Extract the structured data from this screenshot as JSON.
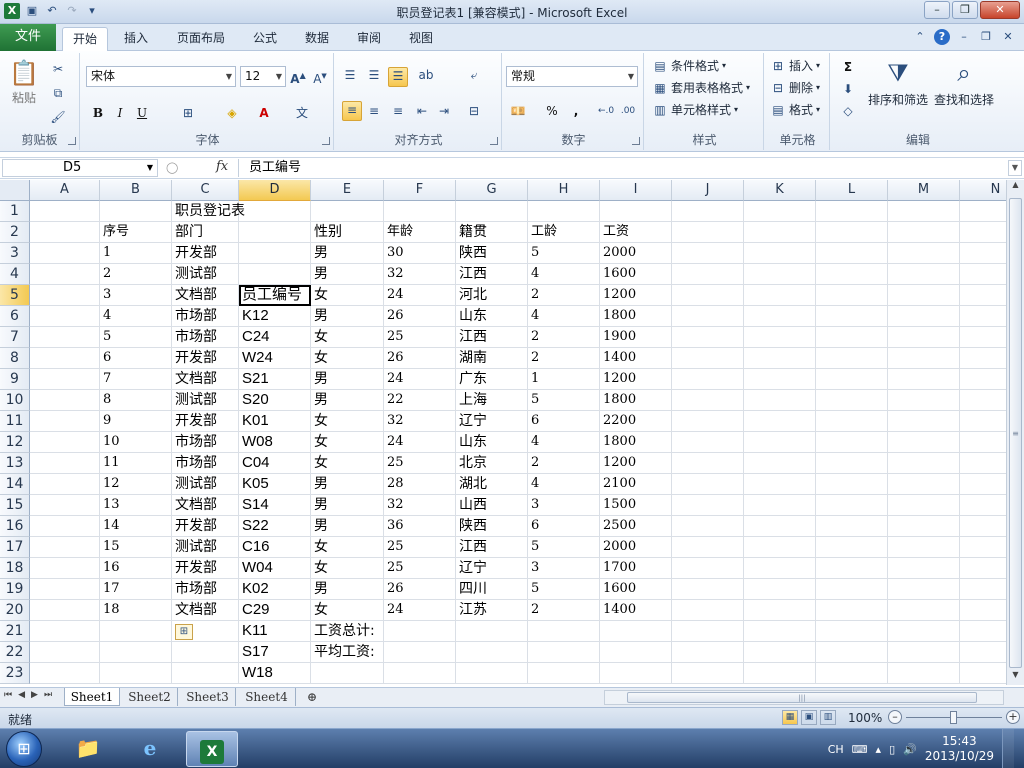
{
  "window": {
    "title": "职员登记表1  [兼容模式] - Microsoft Excel"
  },
  "tabs": [
    "开始",
    "插入",
    "页面布局",
    "公式",
    "数据",
    "审阅",
    "视图"
  ],
  "file_tab": "文件",
  "ribbon": {
    "clipboard": {
      "label": "剪贴板",
      "paste": "粘贴"
    },
    "font": {
      "label": "字体",
      "name": "宋体",
      "size": "12",
      "bold": "B",
      "italic": "I",
      "underline": "U"
    },
    "alignment": {
      "label": "对齐方式"
    },
    "number": {
      "label": "数字",
      "format": "常规",
      "percent": "%",
      "comma": ","
    },
    "styles": {
      "label": "样式",
      "conditional": "条件格式",
      "table": "套用表格格式",
      "cell": "单元格样式"
    },
    "cells": {
      "label": "单元格",
      "insert": "插入",
      "delete": "删除",
      "format": "格式"
    },
    "editing": {
      "label": "编辑",
      "sum": "Σ",
      "sort": "排序和筛选",
      "find": "查找和选择"
    }
  },
  "formula_bar": {
    "name_box": "D5",
    "fx": "fx",
    "content": "员工编号"
  },
  "columns": [
    "A",
    "B",
    "C",
    "D",
    "E",
    "F",
    "G",
    "H",
    "I",
    "J",
    "K",
    "L",
    "M",
    "N"
  ],
  "rows": [
    {
      "n": "1",
      "B": "",
      "C": "职员登记表",
      "D": "",
      "E": "",
      "F": "",
      "G": "",
      "H": "",
      "I": ""
    },
    {
      "n": "2",
      "B": "序号",
      "C": "部门",
      "D": "",
      "E": "性别",
      "F": "年龄",
      "G": "籍贯",
      "H": "工龄",
      "I": "工资"
    },
    {
      "n": "3",
      "B": "1",
      "C": "开发部",
      "D": "",
      "E": "男",
      "F": "30",
      "G": "陕西",
      "H": "5",
      "I": "2000"
    },
    {
      "n": "4",
      "B": "2",
      "C": "测试部",
      "D": "",
      "E": "男",
      "F": "32",
      "G": "江西",
      "H": "4",
      "I": "1600"
    },
    {
      "n": "5",
      "B": "3",
      "C": "文档部",
      "D": "员工编号",
      "E": "女",
      "F": "24",
      "G": "河北",
      "H": "2",
      "I": "1200"
    },
    {
      "n": "6",
      "B": "4",
      "C": "市场部",
      "D": "K12",
      "E": "男",
      "F": "26",
      "G": "山东",
      "H": "4",
      "I": "1800"
    },
    {
      "n": "7",
      "B": "5",
      "C": "市场部",
      "D": "C24",
      "E": "女",
      "F": "25",
      "G": "江西",
      "H": "2",
      "I": "1900"
    },
    {
      "n": "8",
      "B": "6",
      "C": "开发部",
      "D": "W24",
      "E": "女",
      "F": "26",
      "G": "湖南",
      "H": "2",
      "I": "1400"
    },
    {
      "n": "9",
      "B": "7",
      "C": "文档部",
      "D": "S21",
      "E": "男",
      "F": "24",
      "G": "广东",
      "H": "1",
      "I": "1200"
    },
    {
      "n": "10",
      "B": "8",
      "C": "测试部",
      "D": "S20",
      "E": "男",
      "F": "22",
      "G": "上海",
      "H": "5",
      "I": "1800"
    },
    {
      "n": "11",
      "B": "9",
      "C": "开发部",
      "D": "K01",
      "E": "女",
      "F": "32",
      "G": "辽宁",
      "H": "6",
      "I": "2200"
    },
    {
      "n": "12",
      "B": "10",
      "C": "市场部",
      "D": "W08",
      "E": "女",
      "F": "24",
      "G": "山东",
      "H": "4",
      "I": "1800"
    },
    {
      "n": "13",
      "B": "11",
      "C": "市场部",
      "D": "C04",
      "E": "女",
      "F": "25",
      "G": "北京",
      "H": "2",
      "I": "1200"
    },
    {
      "n": "14",
      "B": "12",
      "C": "测试部",
      "D": "K05",
      "E": "男",
      "F": "28",
      "G": "湖北",
      "H": "4",
      "I": "2100"
    },
    {
      "n": "15",
      "B": "13",
      "C": "文档部",
      "D": "S14",
      "E": "男",
      "F": "32",
      "G": "山西",
      "H": "3",
      "I": "1500"
    },
    {
      "n": "16",
      "B": "14",
      "C": "开发部",
      "D": "S22",
      "E": "男",
      "F": "36",
      "G": "陕西",
      "H": "6",
      "I": "2500"
    },
    {
      "n": "17",
      "B": "15",
      "C": "测试部",
      "D": "C16",
      "E": "女",
      "F": "25",
      "G": "江西",
      "H": "5",
      "I": "2000"
    },
    {
      "n": "18",
      "B": "16",
      "C": "开发部",
      "D": "W04",
      "E": "女",
      "F": "25",
      "G": "辽宁",
      "H": "3",
      "I": "1700"
    },
    {
      "n": "19",
      "B": "17",
      "C": "市场部",
      "D": "K02",
      "E": "男",
      "F": "26",
      "G": "四川",
      "H": "5",
      "I": "1600"
    },
    {
      "n": "20",
      "B": "18",
      "C": "文档部",
      "D": "C29",
      "E": "女",
      "F": "24",
      "G": "江苏",
      "H": "2",
      "I": "1400"
    },
    {
      "n": "21",
      "B": "",
      "C": "",
      "D": "K11",
      "E": "工资总计:",
      "F": "",
      "G": "",
      "H": "",
      "I": ""
    },
    {
      "n": "22",
      "B": "",
      "C": "",
      "D": "S17",
      "E": "平均工资:",
      "F": "",
      "G": "",
      "H": "",
      "I": ""
    },
    {
      "n": "23",
      "B": "",
      "C": "",
      "D": "W18",
      "E": "",
      "F": "",
      "G": "",
      "H": "",
      "I": ""
    }
  ],
  "active_cell": "D5",
  "sheets": [
    "Sheet1",
    "Sheet2",
    "Sheet3",
    "Sheet4"
  ],
  "active_sheet": "Sheet1",
  "status": {
    "ready": "就绪",
    "zoom": "100%"
  },
  "tray": {
    "lang": "CH",
    "time": "15:43",
    "date": "2013/10/29"
  }
}
